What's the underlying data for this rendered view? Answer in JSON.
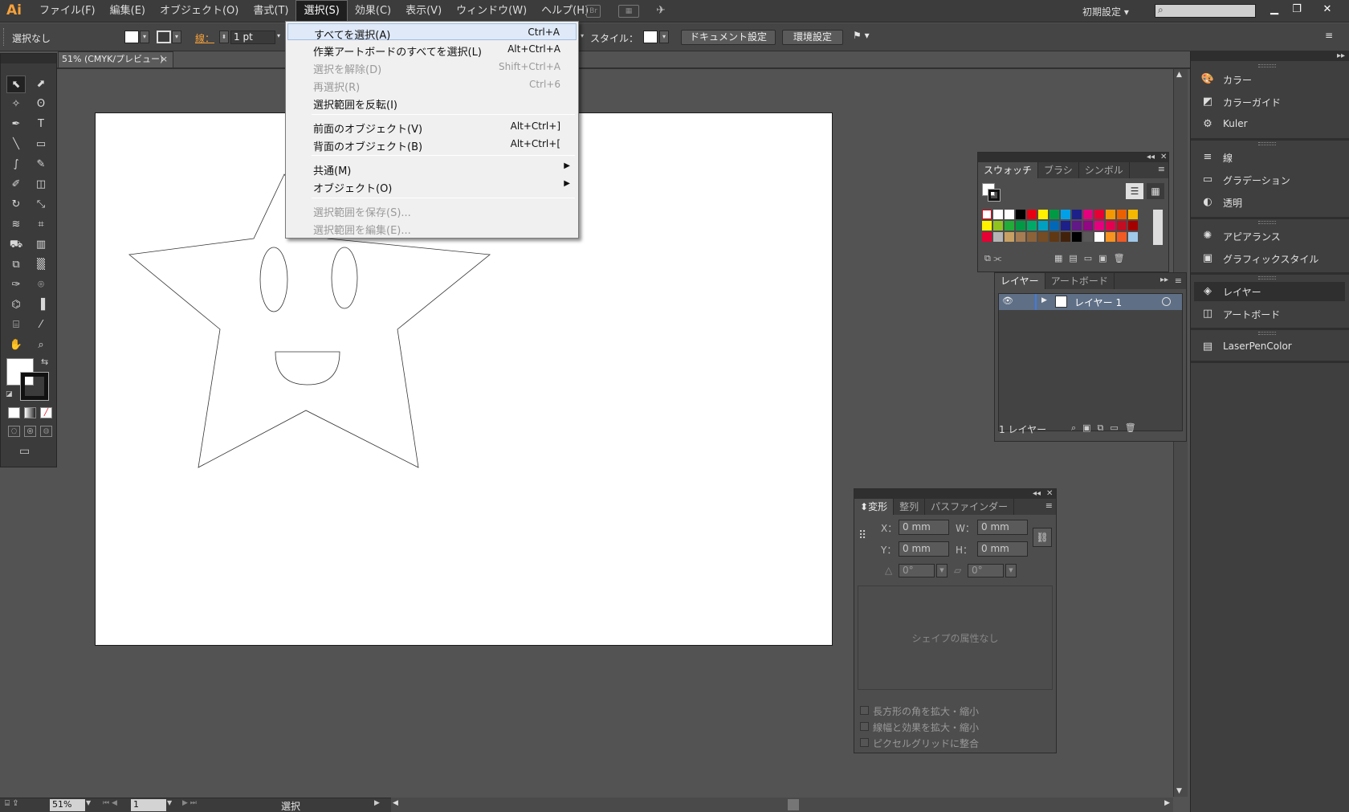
{
  "app": {
    "logo": "Ai"
  },
  "menubar": {
    "items": [
      "ファイル(F)",
      "編集(E)",
      "オブジェクト(O)",
      "書式(T)",
      "選択(S)",
      "効果(C)",
      "表示(V)",
      "ウィンドウ(W)",
      "ヘルプ(H)"
    ],
    "bridge_label": "Br",
    "workspace": "初期設定",
    "workspace_arrow": "▾",
    "search_icon": "⌕",
    "minimize": "▁",
    "restore": "❐",
    "close": "✕"
  },
  "controlbar": {
    "selection_status": "選択なし",
    "stroke_label": "線：",
    "stroke_weight": "1 pt",
    "style_label": "スタイル：",
    "doc_settings_button": "ドキュメント設定",
    "preferences_button": "環境設定",
    "arrow": "▾"
  },
  "document": {
    "tab_title": "51% (CMYK/プレビュー)",
    "close": "×"
  },
  "select_menu": {
    "items": [
      {
        "label": "すべてを選択(A)",
        "shortcut": "Ctrl+A"
      },
      {
        "label": "作業アートボードのすべてを選択(L)",
        "shortcut": "Alt+Ctrl+A"
      },
      {
        "label": "選択を解除(D)",
        "shortcut": "Shift+Ctrl+A"
      },
      {
        "label": "再選択(R)",
        "shortcut": "Ctrl+6"
      },
      {
        "label": "選択範囲を反転(I)",
        "shortcut": ""
      },
      {
        "label": "前面のオブジェクト(V)",
        "shortcut": "Alt+Ctrl+]"
      },
      {
        "label": "背面のオブジェクト(B)",
        "shortcut": "Alt+Ctrl+["
      },
      {
        "label": "共通(M)",
        "shortcut": ""
      },
      {
        "label": "オブジェクト(O)",
        "shortcut": ""
      },
      {
        "label": "選択範囲を保存(S)...",
        "shortcut": ""
      },
      {
        "label": "選択範囲を編集(E)...",
        "shortcut": ""
      }
    ],
    "submenu_arrow": "▶"
  },
  "swatches_panel": {
    "tabs": [
      "スウォッチ",
      "ブラシ",
      "シンボル"
    ],
    "colors": [
      "#ffffff",
      "#ffffff",
      "#ffffff",
      "#000000",
      "#e60012",
      "#fff100",
      "#009944",
      "#00a0e9",
      "#1d2088",
      "#e4007f",
      "#e60033",
      "#f39800",
      "#eb6100",
      "#f6b800",
      "#fff100",
      "#8fc31f",
      "#22ac38",
      "#009944",
      "#00a968",
      "#00a0c1",
      "#0068b7",
      "#1d2088",
      "#601986",
      "#920783",
      "#e4007f",
      "#e5004f",
      "#c30d23",
      "#a40000",
      "#e60033",
      "#b5b5b6",
      "#c9a063",
      "#a67c52",
      "#8c6239",
      "#754c24",
      "#603813",
      "#42210b",
      "#000000",
      "#595757",
      "#ffffff",
      "#f7931e",
      "#f15a24",
      "#a0c8e8"
    ]
  },
  "layers_panel": {
    "tabs": [
      "レイヤー",
      "アートボード"
    ],
    "layer_name": "レイヤー 1",
    "footer_count": "1 レイヤー"
  },
  "transform_panel": {
    "tabs": [
      "変形",
      "整列",
      "パスファインダー"
    ],
    "x_label": "X：",
    "x_value": "0 mm",
    "y_label": "Y：",
    "y_value": "0 mm",
    "w_label": "W：",
    "w_value": "0 mm",
    "h_label": "H：",
    "h_value": "0 mm",
    "rotate_value": "0°",
    "shear_value": "0°",
    "no_shape_text": "シェイプの属性なし",
    "options": [
      "長方形の角を拡大・縮小",
      "線幅と効果を拡大・縮小",
      "ピクセルグリッドに整合"
    ]
  },
  "right_dock": {
    "items": [
      {
        "label": "カラー",
        "icon": "🎨"
      },
      {
        "label": "カラーガイド",
        "icon": "◩"
      },
      {
        "label": "Kuler",
        "icon": "⚙"
      },
      {
        "label": "線",
        "icon": "≡"
      },
      {
        "label": "グラデーション",
        "icon": "▭"
      },
      {
        "label": "透明",
        "icon": "◐"
      },
      {
        "label": "アピアランス",
        "icon": "✺"
      },
      {
        "label": "グラフィックスタイル",
        "icon": "▣"
      },
      {
        "label": "レイヤー",
        "icon": "◈"
      },
      {
        "label": "アートボード",
        "icon": "◫"
      },
      {
        "label": "LaserPenColor",
        "icon": "▤"
      }
    ]
  },
  "statusbar": {
    "zoom": "51%",
    "page": "1",
    "tool_label": "選択"
  },
  "tools": {
    "glyphs": [
      "⬉",
      "⬈",
      "✧",
      "ʘ",
      "✒",
      "T",
      "╲",
      "▭",
      "∫",
      "✎",
      "✐",
      "◫",
      "↻",
      "⤡",
      "≋",
      "⌗",
      "⛟",
      "▥",
      "⧉",
      "▒",
      "✑",
      "⌾",
      "⌬",
      "▐",
      "⌸",
      "⁄",
      "✋",
      "⌕"
    ]
  }
}
